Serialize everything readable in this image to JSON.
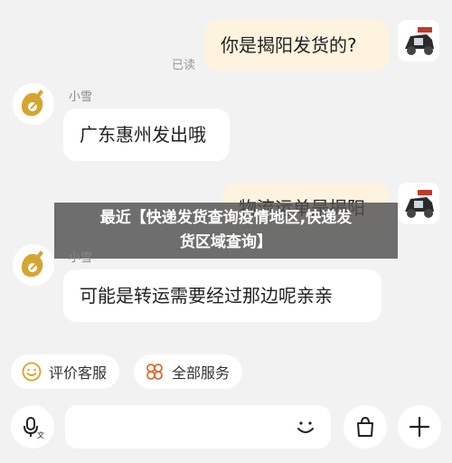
{
  "messages": [
    {
      "from": "me",
      "text": "你是揭阳发货的?",
      "status": "已读"
    },
    {
      "from": "agent",
      "sender": "小雪",
      "text": "广东惠州发出哦"
    },
    {
      "from": "me",
      "text": "物流运单是揭阳"
    },
    {
      "from": "agent",
      "sender": "小雪",
      "text": "可能是转运需要经过那边呢亲亲"
    }
  ],
  "banner": {
    "line1": "最近【快递发货查询疫情地区,快递发",
    "line2": "货区域查询】"
  },
  "quick_actions": [
    {
      "label": "评价客服",
      "icon": "smile-icon"
    },
    {
      "label": "全部服务",
      "icon": "grid-flower-icon"
    }
  ],
  "input": {
    "placeholder": ""
  },
  "colors": {
    "my_bubble": "#fdf3df",
    "their_bubble": "#ffffff",
    "background": "#f2f2f2",
    "agent_logo": "#d6a531"
  }
}
